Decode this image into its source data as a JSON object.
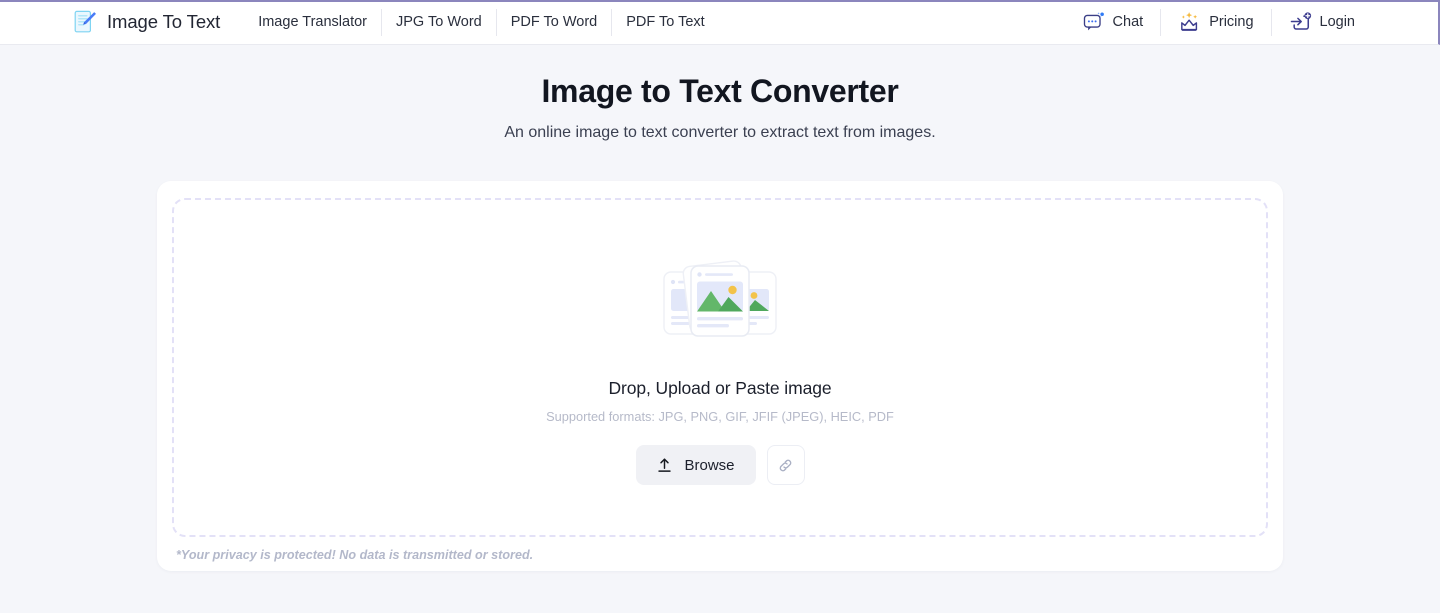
{
  "theme": {
    "page_bg": "#f5f6fa",
    "navbar_bg": "#ffffff",
    "accent_rule": "#8b86bd",
    "dashed_border": "#e3e1f7",
    "muted_text": "#b6bac9",
    "brand_blue": "#4a6ef5",
    "crown_purple": "#3d3d8f"
  },
  "navbar": {
    "brand": {
      "icon": "document-pencil-icon",
      "label": "Image To Text"
    },
    "links": [
      {
        "label": "Image Translator",
        "name": "nav-link-image-translator"
      },
      {
        "label": "JPG To Word",
        "name": "nav-link-jpg-to-word"
      },
      {
        "label": "PDF To Word",
        "name": "nav-link-pdf-to-word"
      },
      {
        "label": "PDF To Text",
        "name": "nav-link-pdf-to-text"
      }
    ],
    "actions": [
      {
        "label": "Chat",
        "icon": "chat-bubble-icon",
        "name": "nav-action-chat"
      },
      {
        "label": "Pricing",
        "icon": "crown-icon",
        "name": "nav-action-pricing"
      },
      {
        "label": "Login",
        "icon": "login-arrow-icon",
        "name": "nav-action-login"
      }
    ]
  },
  "hero": {
    "title": "Image to Text Converter",
    "subtitle": "An online image to text converter to extract text from images."
  },
  "dropzone": {
    "illustration": "stacked-images-icon",
    "title": "Drop, Upload or Paste image",
    "formats": "Supported formats: JPG, PNG, GIF, JFIF (JPEG), HEIC, PDF",
    "browse_label": "Browse",
    "browse_icon": "upload-arrow-icon",
    "link_icon": "paperclip-link-icon"
  },
  "footer": {
    "privacy_note": "*Your privacy is protected! No data is transmitted or stored."
  }
}
